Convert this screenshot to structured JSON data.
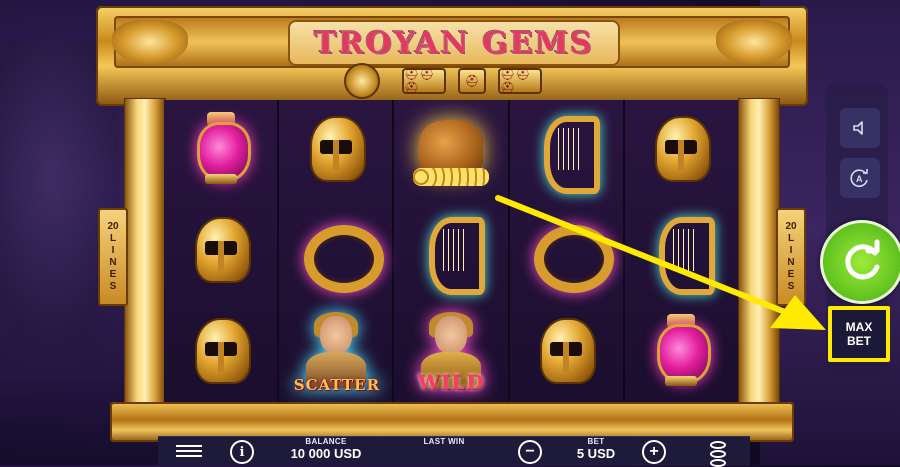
{
  "game": {
    "title": "TROYAN GEMS",
    "lines_tab_number": "20",
    "lines_tab_word": [
      "L",
      "I",
      "N",
      "E",
      "S"
    ]
  },
  "reels": [
    [
      "pink-vase",
      "gold-helmet",
      "gold-helmet"
    ],
    [
      "gold-helmet",
      "gold-ring",
      "scatter-helen"
    ],
    [
      "treasure-bag",
      "gold-harp",
      "wild-warrior"
    ],
    [
      "gold-harp",
      "gold-ring",
      "gold-helmet"
    ],
    [
      "gold-helmet",
      "gold-harp",
      "pink-vase"
    ]
  ],
  "symbols": {
    "scatter_label": "SCATTER",
    "wild_label": "WILD"
  },
  "controls": {
    "max_bet_line1": "MAX",
    "max_bet_line2": "BET",
    "sound_icon": "speaker-icon",
    "autoplay_icon": "autoplay-icon",
    "spin_icon": "spin-arrow-icon"
  },
  "bottom_bar": {
    "balance_label": "BALANCE",
    "balance_value": "10 000 USD",
    "last_win_label": "LAST WIN",
    "last_win_value": "",
    "bet_label": "BET",
    "bet_value": "5 USD",
    "info_glyph": "i",
    "minus_glyph": "−",
    "plus_glyph": "+"
  },
  "colors": {
    "highlight": "#ffea00",
    "spin_green": "#5fc11e",
    "title_red": "#e23a5e",
    "gold": "#d9a23a"
  }
}
